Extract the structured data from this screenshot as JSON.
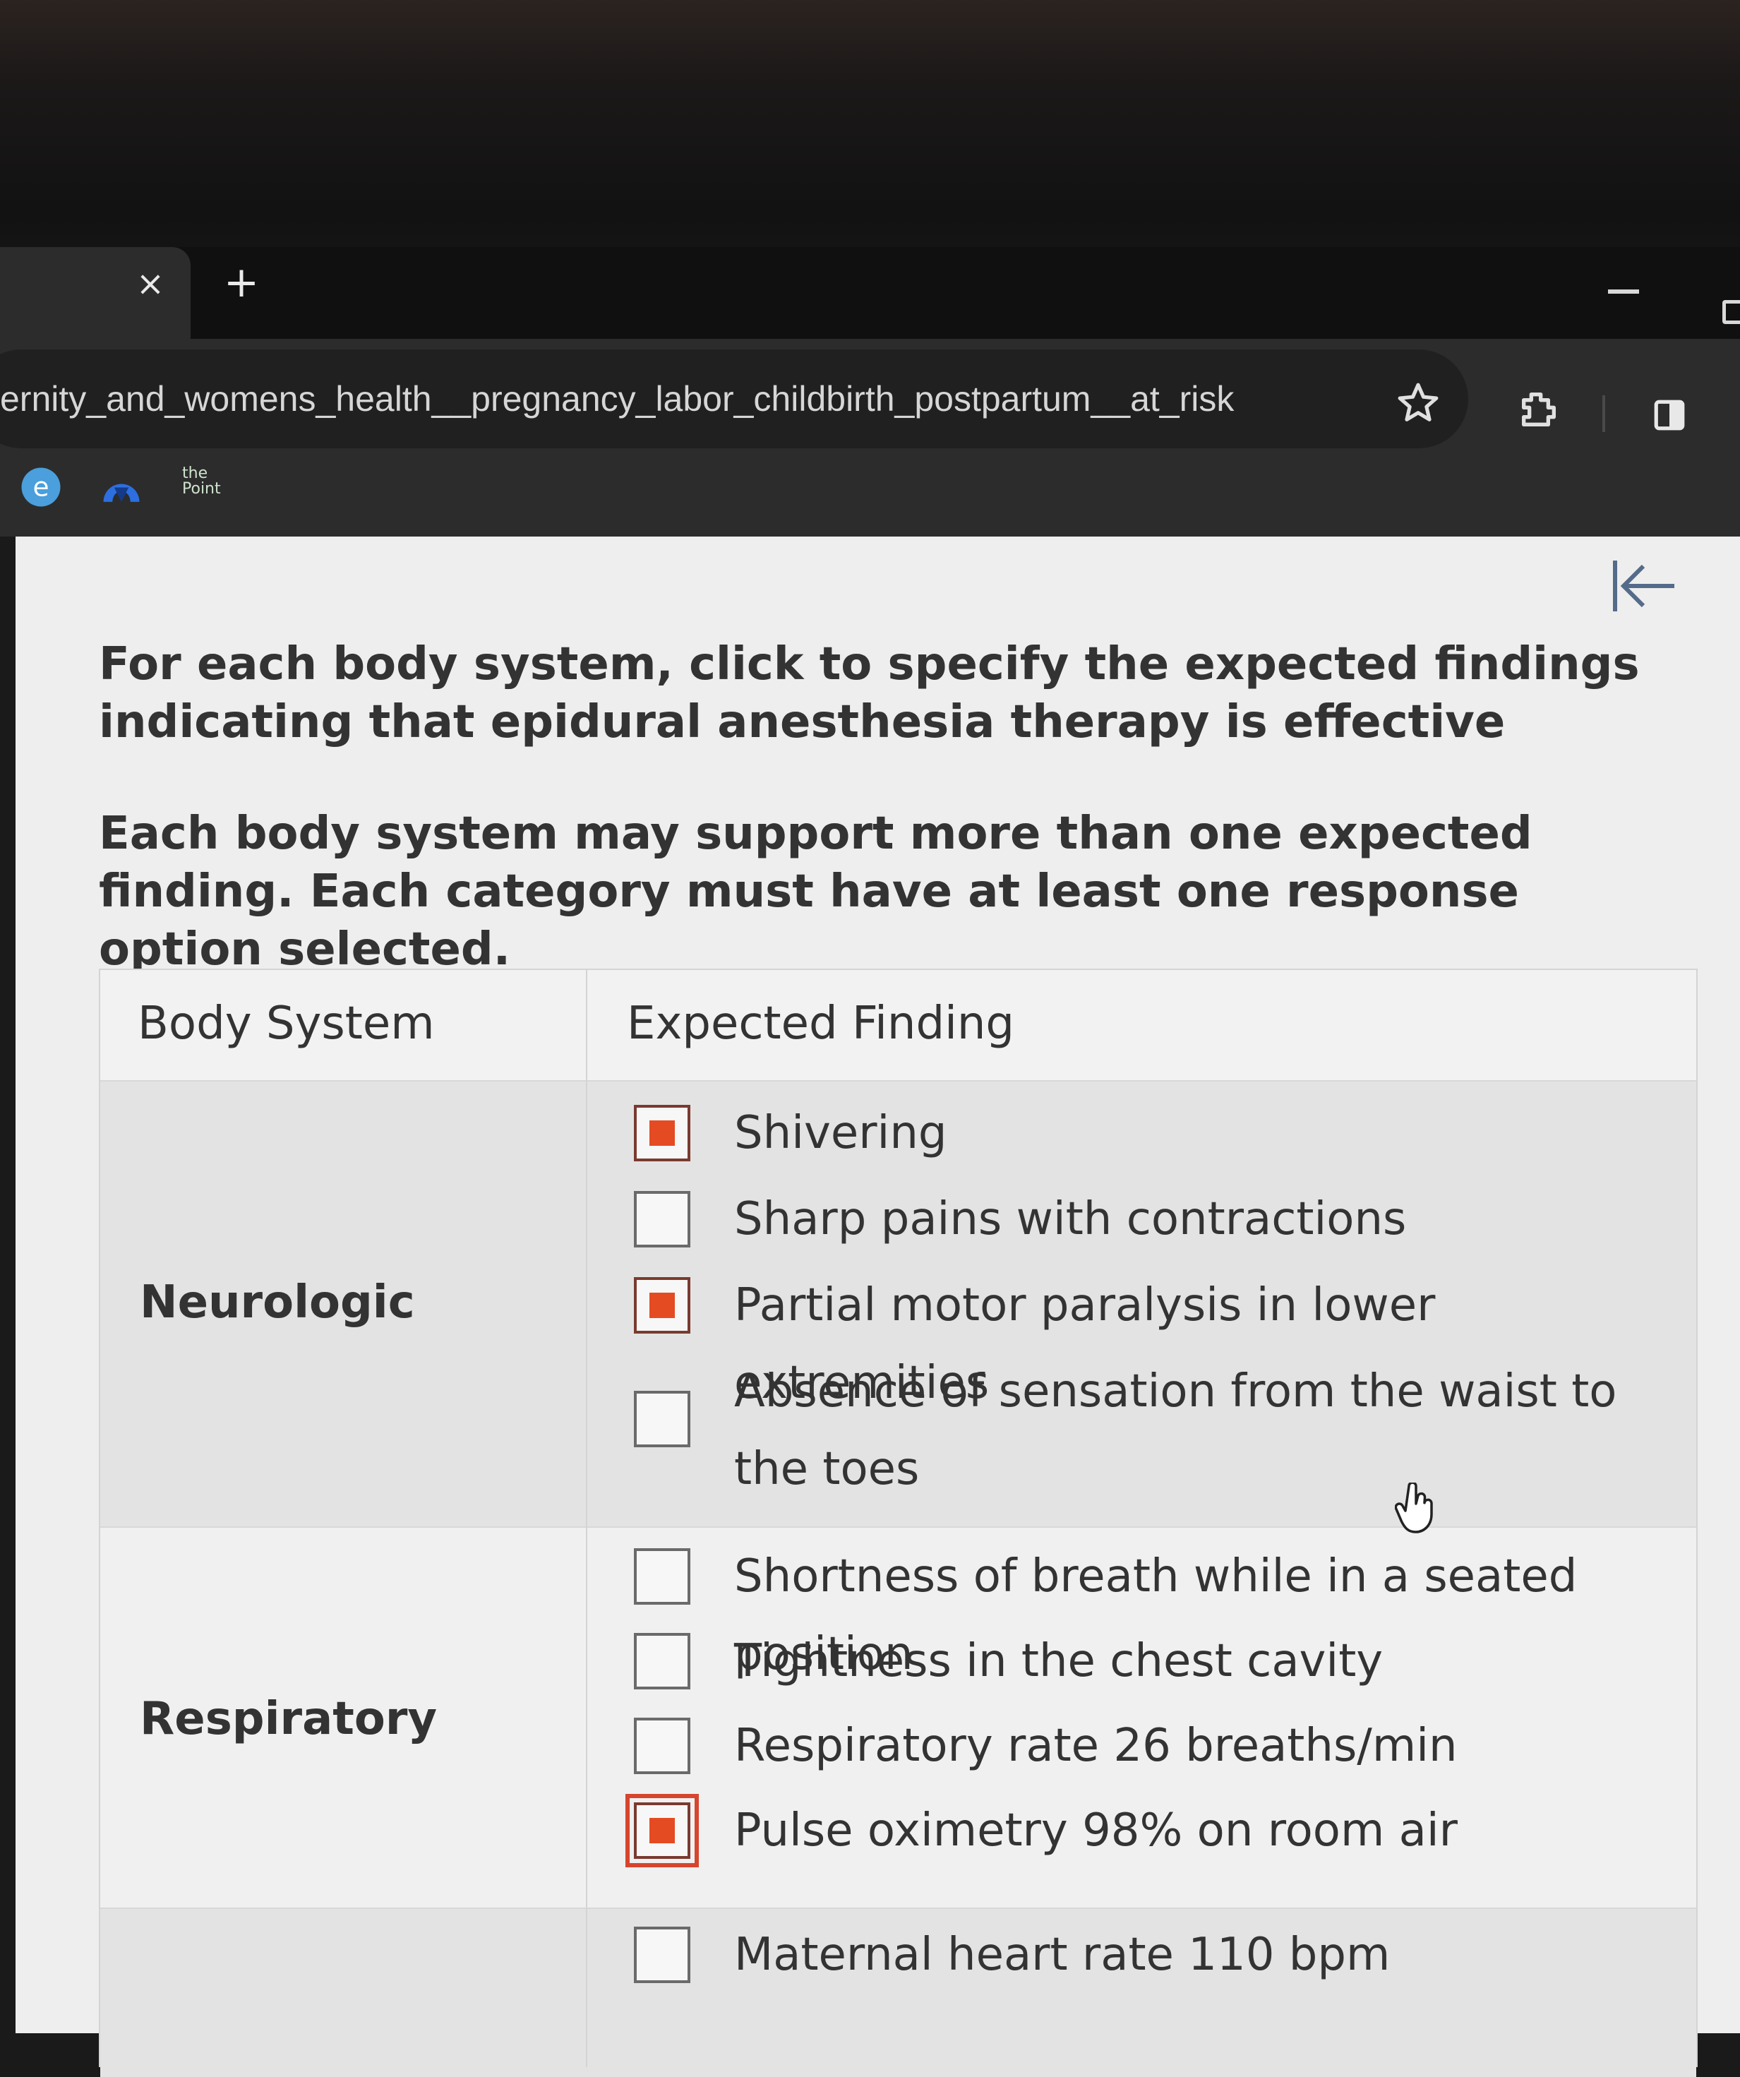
{
  "browser": {
    "tab_close_glyph": "×",
    "new_tab_glyph": "+",
    "url": "ernity_and_womens_health__pregnancy_labor_childbirth_postpartum__at_risk",
    "bookmarks": [
      {
        "icon": "edge-icon",
        "letter": "e"
      },
      {
        "icon": "blue-app-icon"
      },
      {
        "icon": "thepoint-icon",
        "line1": "the",
        "line2": "Point"
      }
    ]
  },
  "question": {
    "instruction_1": "For each body system, click to specify the expected findings indicating that epidural anesthesia therapy is effective",
    "instruction_2": "Each body system may support more than one expected finding. Each category must have at least one response option selected.",
    "header_body_system": "Body System",
    "header_expected_finding": "Expected Finding",
    "systems": [
      {
        "name": "Neurologic",
        "options": [
          {
            "label": "Shivering",
            "checked": true
          },
          {
            "label": "Sharp pains with contractions",
            "checked": false
          },
          {
            "label": "Partial motor paralysis in lower extremities",
            "checked": true
          },
          {
            "label": "Absence of sensation from the waist to the toes",
            "checked": false
          }
        ]
      },
      {
        "name": "Respiratory",
        "options": [
          {
            "label": "Shortness of breath while in a seated position",
            "checked": false
          },
          {
            "label": "Tightness in the chest cavity",
            "checked": false
          },
          {
            "label": "Respiratory rate 26 breaths/min",
            "checked": false
          },
          {
            "label": "Pulse oximetry 98% on room air",
            "checked": true
          }
        ]
      },
      {
        "name": "",
        "options": [
          {
            "label": "Maternal heart rate 110 bpm",
            "checked": false
          }
        ]
      }
    ]
  },
  "colors": {
    "check_fill": "#e54b22",
    "focus_ring": "#d6452e",
    "page_bg": "#eeeeee",
    "chrome_bg": "#2c2c2c"
  }
}
